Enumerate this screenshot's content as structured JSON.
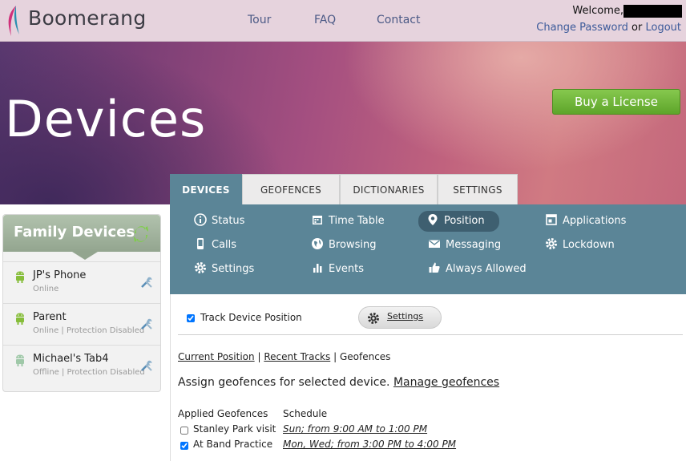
{
  "header": {
    "brand": "Boomerang",
    "nav": [
      "Tour",
      "FAQ",
      "Contact"
    ],
    "welcome": "Welcome,",
    "change_password": "Change Password",
    "or": "or",
    "logout": "Logout"
  },
  "hero": {
    "title": "Devices",
    "buy_label": "Buy a License"
  },
  "tabs": [
    "DEVICES",
    "GEOFENCES",
    "DICTIONARIES",
    "SETTINGS"
  ],
  "subnav": {
    "status": "Status",
    "calls": "Calls",
    "settings": "Settings",
    "timetable": "Time Table",
    "browsing": "Browsing",
    "events": "Events",
    "position": "Position",
    "messaging": "Messaging",
    "always_allowed": "Always Allowed",
    "applications": "Applications",
    "lockdown": "Lockdown"
  },
  "sidebar": {
    "title": "Family Devices",
    "devices": [
      {
        "name": "JP's Phone",
        "status": "Online"
      },
      {
        "name": "Parent",
        "status": "Online | Protection Disabled"
      },
      {
        "name": "Michael's Tab4",
        "status": "Offline | Protection Disabled"
      }
    ]
  },
  "content": {
    "track_label": "Track Device Position",
    "track_checked": true,
    "settings_label": "Settings",
    "subtab_current": "Current Position",
    "subtab_recent": "Recent Tracks",
    "subtab_sep": "|",
    "subtab_geofences": "Geofences",
    "assign_text": "Assign geofences for selected device.",
    "manage_link": "Manage geofences",
    "col_applied": "Applied Geofences",
    "col_schedule": "Schedule",
    "geofences": [
      {
        "name": "Stanley Park visit",
        "schedule": "Sun; from 9:00 AM to 1:00 PM",
        "checked": false
      },
      {
        "name": "At Band Practice",
        "schedule": "Mon, Wed; from 3:00 PM to 4:00 PM",
        "checked": true
      }
    ]
  },
  "colors": {
    "accent_teal": "#5b8597",
    "buy_green": "#6fb536",
    "header_bg": "#e6d3dd"
  }
}
